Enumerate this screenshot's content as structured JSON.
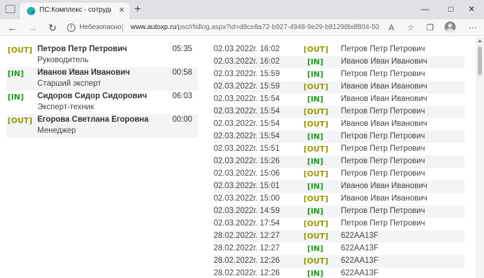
{
  "browser": {
    "tab_title": "ПС:Комплекс - сотрудники",
    "tab_close": "✕",
    "new_tab": "+",
    "window": {
      "minimize": "—",
      "maximize": "□",
      "close": "✕"
    },
    "nav": {
      "back": "←",
      "forward": "→",
      "reload": "↻"
    },
    "insecure_label": "Небезопасно",
    "url_host": "www.autoxp.ru",
    "url_path": "/psc/rfidlog.aspx?id=d8ce8a72-b927-4948-9e29-b81298bdf804-505343...",
    "icons": [
      "read-aloud-icon",
      "favorites-star-icon",
      "collections-icon",
      "extensions-icon",
      "profile-avatar-icon",
      "more-menu-icon"
    ]
  },
  "colors": {
    "out": "#9a9a00",
    "in": "#1a9a1a",
    "row_alt": "#f2f4f6"
  },
  "staff": [
    {
      "status": "[OUT]",
      "type": "out",
      "name": "Петров Петр Петрович",
      "role": "Руководитель",
      "time": "05:35"
    },
    {
      "status": "[IN]",
      "type": "in",
      "name": "Иванов Иван Иванович",
      "role": "Старший эксперт",
      "time": "00:58"
    },
    {
      "status": "[IN]",
      "type": "in",
      "name": "Сидоров Сидор Сидорович",
      "role": "Эксперт-техник",
      "time": "06:03"
    },
    {
      "status": "[OUT]",
      "type": "out",
      "name": "Егорова Светлана Егоровна",
      "role": "Менеджер",
      "time": "00:00"
    }
  ],
  "log": [
    {
      "date": "02.03.2022г. 16:02",
      "status": "[OUT]",
      "type": "out",
      "name": "Петров Петр Петрович"
    },
    {
      "date": "02.03.2022г. 16:02",
      "status": "[IN]",
      "type": "in",
      "name": "Иванов Иван Иванович"
    },
    {
      "date": "02.03.2022г. 15:59",
      "status": "[IN]",
      "type": "in",
      "name": "Петров Петр Петрович"
    },
    {
      "date": "02.03.2022г. 15:59",
      "status": "[OUT]",
      "type": "out",
      "name": "Иванов Иван Иванович"
    },
    {
      "date": "02.03.2022г. 15:54",
      "status": "[IN]",
      "type": "in",
      "name": "Иванов Иван Иванович"
    },
    {
      "date": "02.03.2022г. 15:54",
      "status": "[OUT]",
      "type": "out",
      "name": "Петров Петр Петрович"
    },
    {
      "date": "02.03.2022г. 15:54",
      "status": "[OUT]",
      "type": "out",
      "name": "Иванов Иван Иванович"
    },
    {
      "date": "02.03.2022г. 15:54",
      "status": "[IN]",
      "type": "in",
      "name": "Петров Петр Петрович"
    },
    {
      "date": "02.03.2022г. 15:51",
      "status": "[OUT]",
      "type": "out",
      "name": "Петров Петр Петрович"
    },
    {
      "date": "02.03.2022г. 15:26",
      "status": "[IN]",
      "type": "in",
      "name": "Петров Петр Петрович"
    },
    {
      "date": "02.03.2022г. 15:06",
      "status": "[OUT]",
      "type": "out",
      "name": "Петров Петр Петрович"
    },
    {
      "date": "02.03.2022г. 15:01",
      "status": "[IN]",
      "type": "in",
      "name": "Иванов Иван Иванович"
    },
    {
      "date": "02.03.2022г. 15:00",
      "status": "[OUT]",
      "type": "out",
      "name": "Иванов Иван Иванович"
    },
    {
      "date": "02.03.2022г. 14:59",
      "status": "[IN]",
      "type": "in",
      "name": "Петров Петр Петрович"
    },
    {
      "date": "02.03.2022г. 17:54",
      "status": "[OUT]",
      "type": "out",
      "name": "Петров Петр Петрович"
    },
    {
      "date": "28.02.2022г. 12:27",
      "status": "[OUT]",
      "type": "out",
      "name": "622AA13F"
    },
    {
      "date": "28.02.2022г. 12:27",
      "status": "[IN]",
      "type": "in",
      "name": "622AA13F"
    },
    {
      "date": "28.02.2022г. 12:26",
      "status": "[OUT]",
      "type": "out",
      "name": "622AA13F"
    },
    {
      "date": "28.02.2022г. 12:26",
      "status": "[IN]",
      "type": "in",
      "name": "622AA13F"
    }
  ]
}
